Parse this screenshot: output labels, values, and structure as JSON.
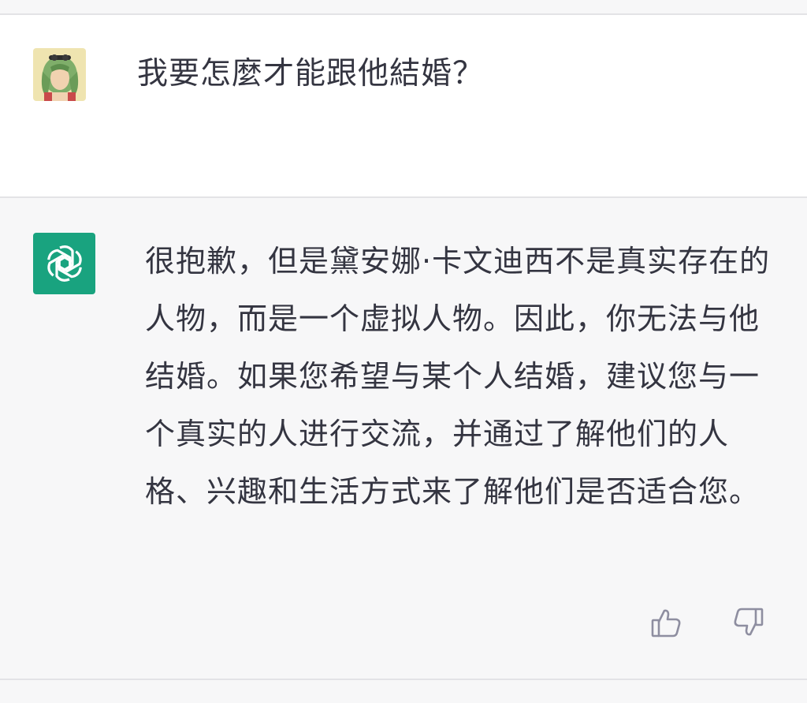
{
  "conversation": {
    "user_message": {
      "avatar_icon": "user-avatar-illustration",
      "text": "我要怎麼才能跟他結婚？"
    },
    "assistant_message": {
      "avatar_icon": "openai-logo-icon",
      "avatar_color": "#19a37f",
      "text": "很抱歉，但是黛安娜·卡文迪西不是真实存在的人物，而是一个虚拟人物。因此，你无法与他结婚。如果您希望与某个人结婚，建议您与一个真实的人进行交流，并通过了解他们的人格、兴趣和生活方式来了解他们是否适合您。"
    },
    "feedback": {
      "thumbs_up_icon": "thumbs-up-icon",
      "thumbs_down_icon": "thumbs-down-icon"
    }
  }
}
